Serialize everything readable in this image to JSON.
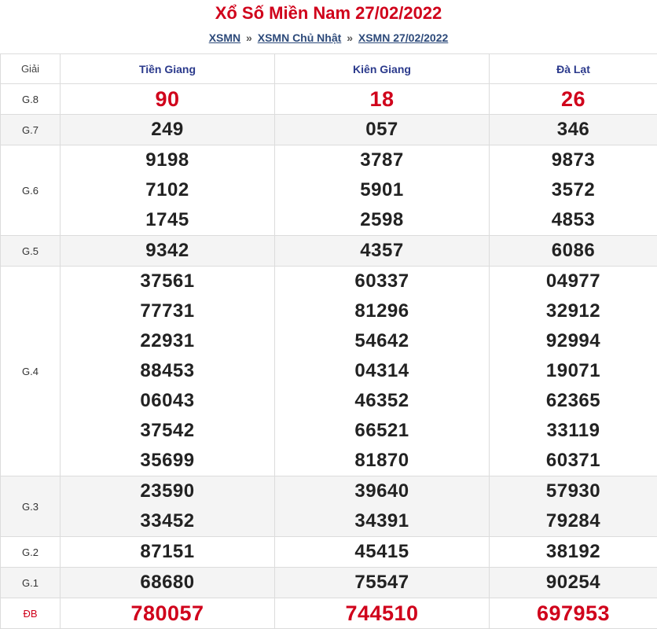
{
  "header": {
    "title": "Xổ Số Miền Nam 27/02/2022",
    "breadcrumb": [
      {
        "label": "XSMN"
      },
      {
        "label": "XSMN Chủ Nhật"
      },
      {
        "label": "XSMN 27/02/2022"
      }
    ],
    "separator": "»"
  },
  "table": {
    "label_header": "Giải",
    "provinces": [
      "Tiền Giang",
      "Kiên Giang",
      "Đà Lạt"
    ],
    "rows": [
      {
        "label": "G.8",
        "values": [
          [
            "90"
          ],
          [
            "18"
          ],
          [
            "26"
          ]
        ]
      },
      {
        "label": "G.7",
        "values": [
          [
            "249"
          ],
          [
            "057"
          ],
          [
            "346"
          ]
        ]
      },
      {
        "label": "G.6",
        "values": [
          [
            "9198",
            "7102",
            "1745"
          ],
          [
            "3787",
            "5901",
            "2598"
          ],
          [
            "9873",
            "3572",
            "4853"
          ]
        ]
      },
      {
        "label": "G.5",
        "values": [
          [
            "9342"
          ],
          [
            "4357"
          ],
          [
            "6086"
          ]
        ]
      },
      {
        "label": "G.4",
        "values": [
          [
            "37561",
            "77731",
            "22931",
            "88453",
            "06043",
            "37542",
            "35699"
          ],
          [
            "60337",
            "81296",
            "54642",
            "04314",
            "46352",
            "66521",
            "81870"
          ],
          [
            "04977",
            "32912",
            "92994",
            "19071",
            "62365",
            "33119",
            "60371"
          ]
        ]
      },
      {
        "label": "G.3",
        "values": [
          [
            "23590",
            "33452"
          ],
          [
            "39640",
            "34391"
          ],
          [
            "57930",
            "79284"
          ]
        ]
      },
      {
        "label": "G.2",
        "values": [
          [
            "87151"
          ],
          [
            "45415"
          ],
          [
            "38192"
          ]
        ]
      },
      {
        "label": "G.1",
        "values": [
          [
            "68680"
          ],
          [
            "75547"
          ],
          [
            "90254"
          ]
        ]
      },
      {
        "label": "ĐB",
        "values": [
          [
            "780057"
          ],
          [
            "744510"
          ],
          [
            "697953"
          ]
        ]
      }
    ]
  },
  "colors": {
    "title": "#d0021b",
    "link": "#2d4a7a",
    "province": "#2b3a8c",
    "highlight": "#d0021b"
  }
}
